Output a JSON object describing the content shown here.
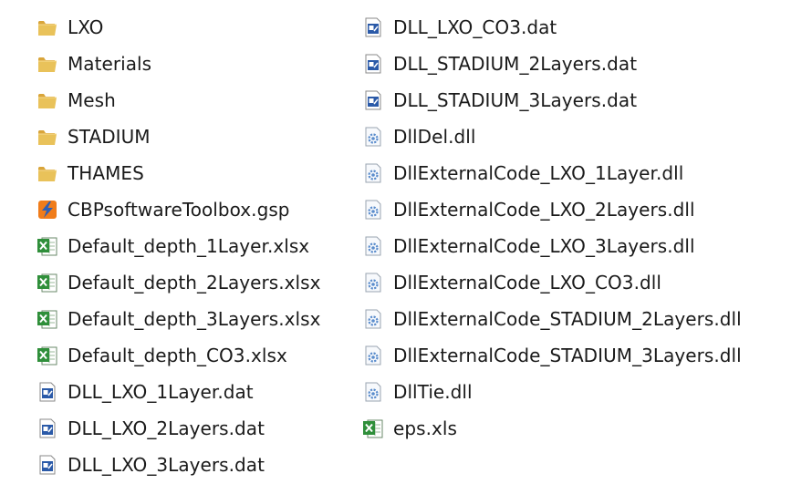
{
  "files": {
    "left": [
      {
        "name": "LXO",
        "type": "folder"
      },
      {
        "name": "Materials",
        "type": "folder"
      },
      {
        "name": "Mesh",
        "type": "folder"
      },
      {
        "name": "STADIUM",
        "type": "folder"
      },
      {
        "name": "THAMES",
        "type": "folder"
      },
      {
        "name": "CBPsoftwareToolbox.gsp",
        "type": "gsp"
      },
      {
        "name": "Default_depth_1Layer.xlsx",
        "type": "excel"
      },
      {
        "name": "Default_depth_2Layers.xlsx",
        "type": "excel"
      },
      {
        "name": "Default_depth_3Layers.xlsx",
        "type": "excel"
      },
      {
        "name": "Default_depth_CO3.xlsx",
        "type": "excel"
      },
      {
        "name": "DLL_LXO_1Layer.dat",
        "type": "dat"
      },
      {
        "name": "DLL_LXO_2Layers.dat",
        "type": "dat"
      },
      {
        "name": "DLL_LXO_3Layers.dat",
        "type": "dat"
      }
    ],
    "right": [
      {
        "name": "DLL_LXO_CO3.dat",
        "type": "dat"
      },
      {
        "name": "DLL_STADIUM_2Layers.dat",
        "type": "dat"
      },
      {
        "name": "DLL_STADIUM_3Layers.dat",
        "type": "dat"
      },
      {
        "name": "DllDel.dll",
        "type": "dll"
      },
      {
        "name": "DllExternalCode_LXO_1Layer.dll",
        "type": "dll"
      },
      {
        "name": "DllExternalCode_LXO_2Layers.dll",
        "type": "dll"
      },
      {
        "name": "DllExternalCode_LXO_3Layers.dll",
        "type": "dll"
      },
      {
        "name": "DllExternalCode_LXO_CO3.dll",
        "type": "dll"
      },
      {
        "name": "DllExternalCode_STADIUM_2Layers.dll",
        "type": "dll"
      },
      {
        "name": "DllExternalCode_STADIUM_3Layers.dll",
        "type": "dll"
      },
      {
        "name": "DllTie.dll",
        "type": "dll"
      },
      {
        "name": "eps.xls",
        "type": "excel"
      }
    ]
  },
  "icons": {
    "folder": "folder-icon",
    "gsp": "gsp-file-icon",
    "excel": "excel-file-icon",
    "dat": "dat-file-icon",
    "dll": "dll-file-icon"
  },
  "colors": {
    "folder_body": "#e9c25a",
    "folder_tab": "#d9a53a",
    "excel_green": "#2f8f3a",
    "gsp_orange": "#f07c1a",
    "gsp_blue": "#2d5fb5",
    "dat_blue": "#2b5aa8",
    "dll_gear": "#5a8ccc"
  }
}
